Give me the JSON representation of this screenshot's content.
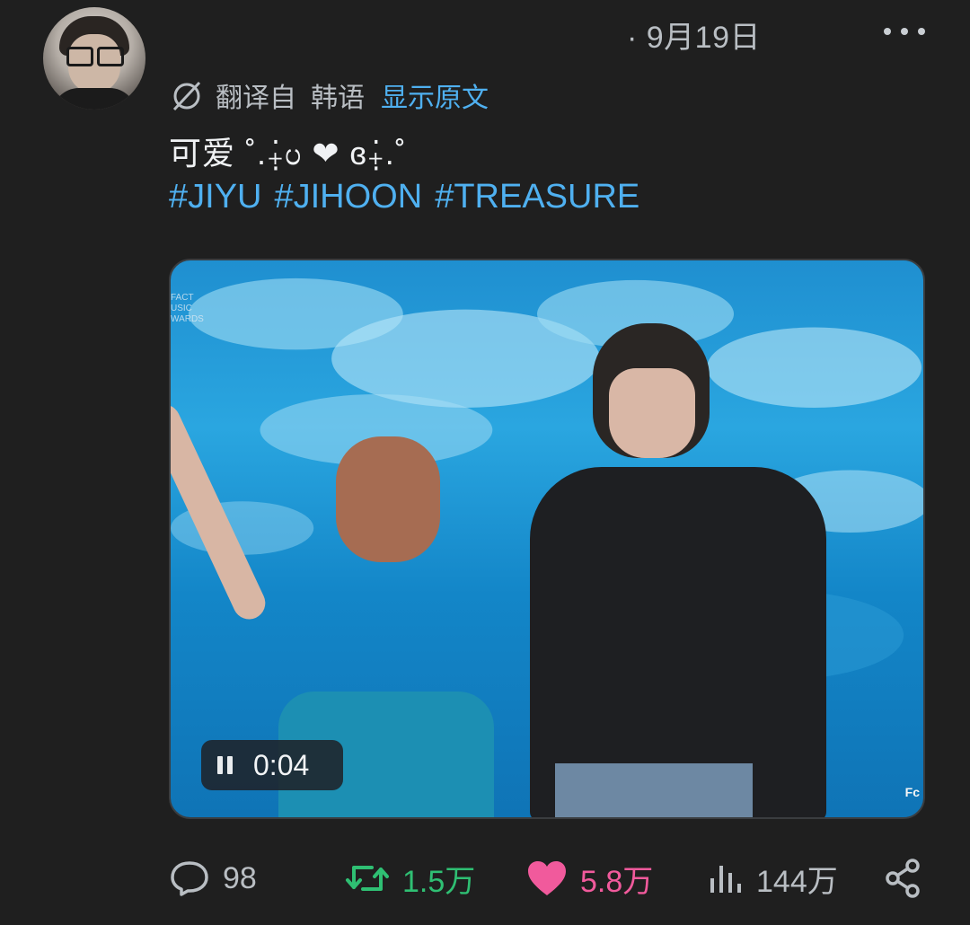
{
  "tweet": {
    "date": "· 9月19日",
    "translation": {
      "label": "翻译自",
      "language": "韩语",
      "show_original": "显示原文"
    },
    "text": "可爱 ˚.₊̣̇ᦢ ❤ ɞ₊̣̇.˚",
    "hashtags": [
      "#JIYU",
      "#JIHOON",
      "#TREASURE"
    ]
  },
  "media": {
    "type": "video",
    "time": "0:04",
    "watermark": "FACT\nUSIC\nWARDS",
    "corner_mark": "Fc"
  },
  "actions": {
    "replies": "98",
    "retweets": "1.5万",
    "likes": "5.8万",
    "views": "144万"
  },
  "colors": {
    "background": "#1f1f1f",
    "link": "#4fb0f0",
    "retweet": "#2fbf73",
    "like": "#f15a9c",
    "muted": "#b9bec3"
  },
  "icons": {
    "more": "more-horizontal-icon",
    "translate": "translate-slash-icon",
    "pause": "pause-icon",
    "reply": "reply-bubble-icon",
    "retweet": "retweet-icon",
    "like": "heart-icon",
    "views": "bar-chart-icon",
    "share": "share-icon"
  }
}
